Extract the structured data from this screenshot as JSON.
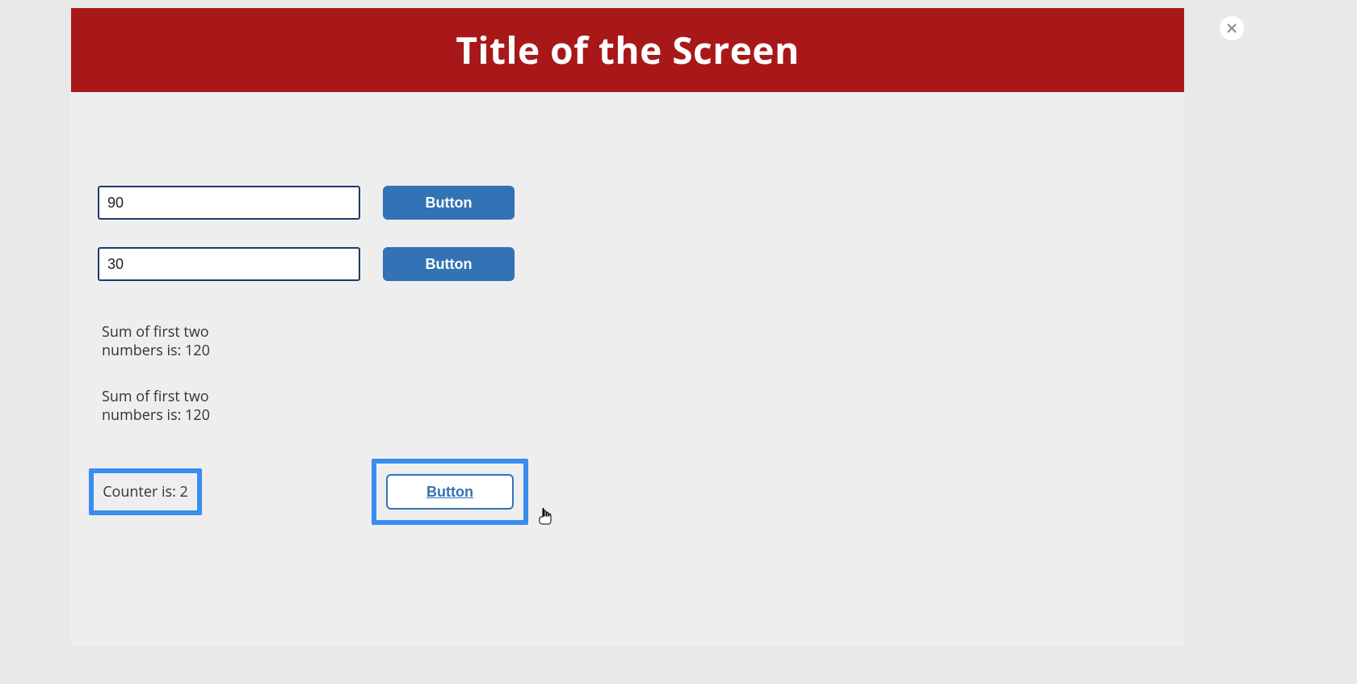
{
  "header": {
    "title": "Title of the Screen"
  },
  "inputs": {
    "field1_value": "90",
    "field2_value": "30"
  },
  "buttons": {
    "button1_label": "Button",
    "button2_label": "Button",
    "button3_label": "Button"
  },
  "results": {
    "sum_line1": "Sum of first two numbers is: 120",
    "sum_line2": "Sum of first two numbers is: 120"
  },
  "counter": {
    "label": "Counter is: 2"
  }
}
